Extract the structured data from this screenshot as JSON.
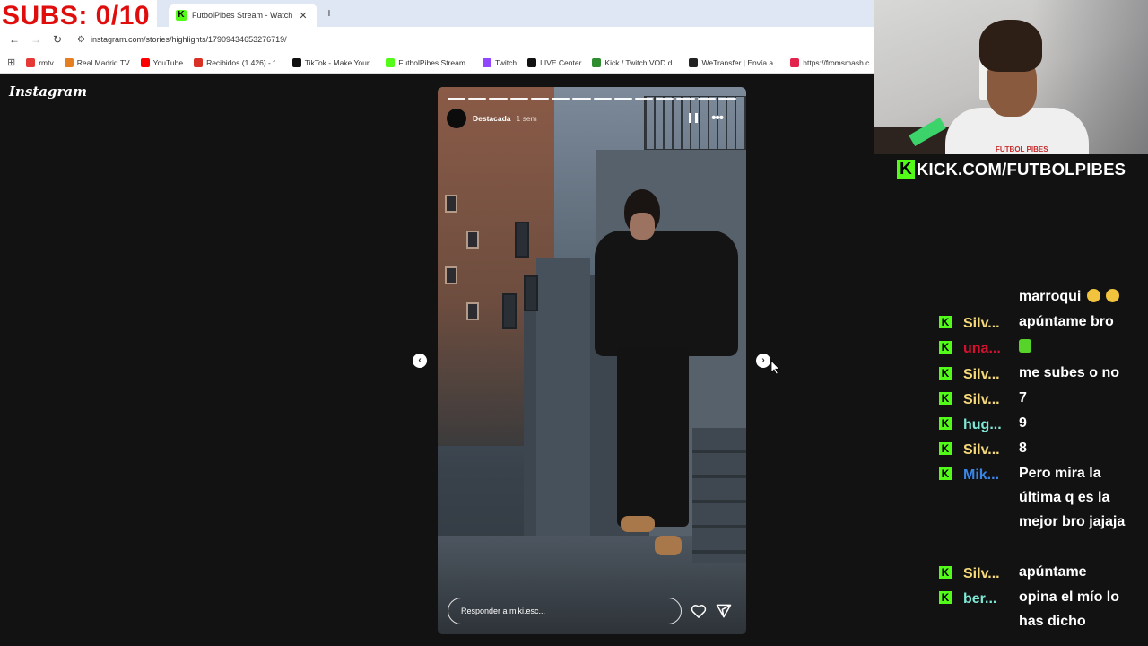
{
  "overlay": {
    "subs_label": "SUBS: 0/10",
    "kick_url": "KICK.COM/FUTBOLPIBES",
    "webcam_logo": "FUTBOL PIBES"
  },
  "browser": {
    "tab": {
      "title": "FutbolPibes Stream - Watch Li"
    },
    "url": "instagram.com/stories/highlights/17909434653276719/",
    "bookmarks": [
      {
        "label": "rmtv",
        "color": "#e53935"
      },
      {
        "label": "Real Madrid TV",
        "color": "#e67e22"
      },
      {
        "label": "YouTube",
        "color": "#ff0000"
      },
      {
        "label": "Recibidos (1.426) - f...",
        "color": "#d93025"
      },
      {
        "label": "TikTok - Make Your...",
        "color": "#111111"
      },
      {
        "label": "FutbolPibes Stream...",
        "color": "#53fc18"
      },
      {
        "label": "Twitch",
        "color": "#9146ff"
      },
      {
        "label": "LIVE Center",
        "color": "#111111"
      },
      {
        "label": "Kick / Twitch VOD d...",
        "color": "#2f8d2f"
      },
      {
        "label": "WeTransfer | Envía a...",
        "color": "#222222"
      },
      {
        "label": "https://fromsmash.c...",
        "color": "#e3234b"
      }
    ]
  },
  "instagram": {
    "logo": "Instagram",
    "story": {
      "user": "Destacada",
      "time": "1 sem",
      "reply_placeholder": "Responder a miki.esc..."
    }
  },
  "chat": [
    {
      "user": "",
      "user_color": "#ffffff",
      "message": "marroqui",
      "emoji": "laugh2"
    },
    {
      "user": "Silv...",
      "user_color": "#f5d97a",
      "message": "apúntame bro"
    },
    {
      "user": "una...",
      "user_color": "#d4122f",
      "message": "",
      "emoji": "green"
    },
    {
      "user": "Silv...",
      "user_color": "#f5d97a",
      "message": "me subes o no"
    },
    {
      "user": "Silv...",
      "user_color": "#f5d97a",
      "message": "7"
    },
    {
      "user": "hug...",
      "user_color": "#7fe8d6",
      "message": "9"
    },
    {
      "user": "Silv...",
      "user_color": "#f5d97a",
      "message": "8"
    },
    {
      "user": "Mik...",
      "user_color": "#3a86e8",
      "message": "Pero mira la última q es la mejor bro jajaja"
    },
    {
      "user": "Silv...",
      "user_color": "#f5d97a",
      "message": "apúntame"
    },
    {
      "user": "ber...",
      "user_color": "#7fe8d6",
      "message": "opina el mío lo has dicho"
    }
  ]
}
